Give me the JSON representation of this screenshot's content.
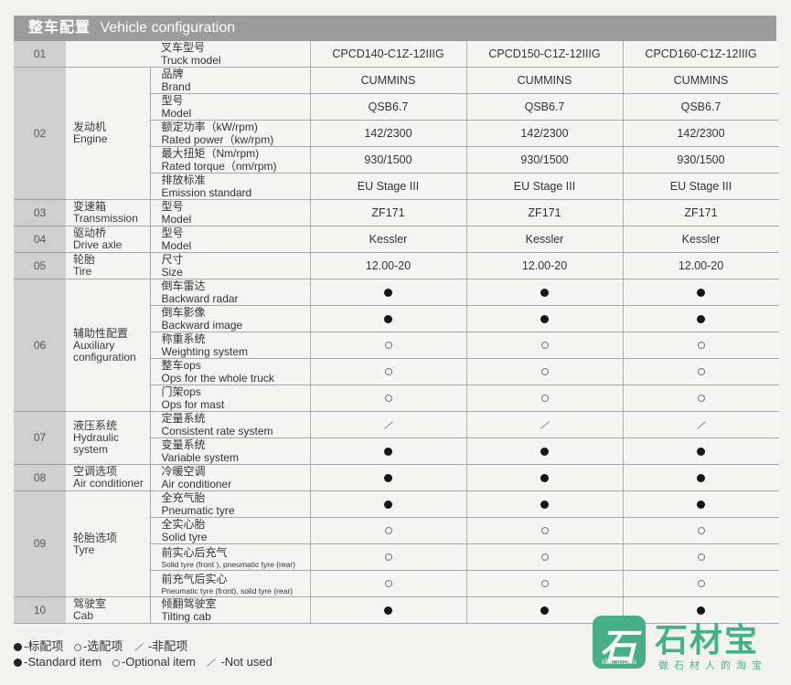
{
  "title": {
    "cn": "整车配置",
    "en": "Vehicle configuration"
  },
  "models": [
    "CPCD140-C1Z-12IIIG",
    "CPCD150-C1Z-12IIIG",
    "CPCD160-C1Z-12IIIG"
  ],
  "truck_model_label": {
    "cn": "叉车型号",
    "en": "Truck model"
  },
  "sections": [
    {
      "num": "01"
    },
    {
      "num": "02",
      "cat_cn": "发动机",
      "cat_en": "Engine",
      "items": [
        {
          "cn": "品牌",
          "en": "Brand",
          "values": [
            "CUMMINS",
            "CUMMINS",
            "CUMMINS"
          ]
        },
        {
          "cn": "型号",
          "en": "Model",
          "values": [
            "QSB6.7",
            "QSB6.7",
            "QSB6.7"
          ]
        },
        {
          "cn": "额定功率（kW/rpm)",
          "en": "Rated power（kw/rpm)",
          "values": [
            "142/2300",
            "142/2300",
            "142/2300"
          ]
        },
        {
          "cn": "最大扭矩（Nm/rpm)",
          "en": "Rated torque（nm/rpm)",
          "values": [
            "930/1500",
            "930/1500",
            "930/1500"
          ]
        },
        {
          "cn": "排放标准",
          "en": "Emission standard",
          "values": [
            "EU Stage III",
            "EU Stage III",
            "EU Stage III"
          ]
        }
      ]
    },
    {
      "num": "03",
      "cat_cn": "变速箱",
      "cat_en": "Transmission",
      "items": [
        {
          "cn": "型号",
          "en": "Model",
          "values": [
            "ZF171",
            "ZF171",
            "ZF171"
          ]
        }
      ]
    },
    {
      "num": "04",
      "cat_cn": "驱动桥",
      "cat_en": "Drive axle",
      "items": [
        {
          "cn": "型号",
          "en": "Model",
          "values": [
            "Kessler",
            "Kessler",
            "Kessler"
          ]
        }
      ]
    },
    {
      "num": "05",
      "cat_cn": "轮胎",
      "cat_en": "Tire",
      "items": [
        {
          "cn": "尺寸",
          "en": "Size",
          "values": [
            "12.00-20",
            "12.00-20",
            "12.00-20"
          ]
        }
      ]
    },
    {
      "num": "06",
      "cat_cn": "辅助性配置",
      "cat_en": "Auxiliary configuration",
      "items": [
        {
          "cn": "倒车雷达",
          "en": "Backward radar",
          "values": [
            "standard",
            "standard",
            "standard"
          ]
        },
        {
          "cn": "倒车影像",
          "en": "Backward image",
          "values": [
            "standard",
            "standard",
            "standard"
          ]
        },
        {
          "cn": "称重系统",
          "en": "Weighting system",
          "values": [
            "optional",
            "optional",
            "optional"
          ]
        },
        {
          "cn": "整车ops",
          "en": "Ops for the whole truck",
          "values": [
            "optional",
            "optional",
            "optional"
          ]
        },
        {
          "cn": "门架ops",
          "en": "Ops for mast",
          "values": [
            "optional",
            "optional",
            "optional"
          ]
        }
      ]
    },
    {
      "num": "07",
      "cat_cn": "液压系统",
      "cat_en": "Hydraulic system",
      "items": [
        {
          "cn": "定量系统",
          "en": "Consistent rate system",
          "values": [
            "not_used",
            "not_used",
            "not_used"
          ]
        },
        {
          "cn": "变量系统",
          "en": "Variable system",
          "values": [
            "standard",
            "standard",
            "standard"
          ]
        }
      ]
    },
    {
      "num": "08",
      "cat_cn": "空调选项",
      "cat_en": "Air conditioner",
      "items": [
        {
          "cn": "冷暖空调",
          "en": "Air conditioner",
          "values": [
            "standard",
            "standard",
            "standard"
          ]
        }
      ]
    },
    {
      "num": "09",
      "cat_cn": "轮胎选项",
      "cat_en": "Tyre",
      "items": [
        {
          "cn": "全充气胎",
          "en": "Pneumatic tyre",
          "values": [
            "standard",
            "standard",
            "standard"
          ]
        },
        {
          "cn": "全实心胎",
          "en": "Solid tyre",
          "values": [
            "optional",
            "optional",
            "optional"
          ]
        },
        {
          "cn": "前实心后充气",
          "en": "Solid tyre (front ), pneumatic tyre (rear)",
          "small": true,
          "values": [
            "optional",
            "optional",
            "optional"
          ]
        },
        {
          "cn": "前充气后实心",
          "en": "Pneumatic tyre (front), solid tyre (rear)",
          "small": true,
          "values": [
            "optional",
            "optional",
            "optional"
          ]
        }
      ]
    },
    {
      "num": "10",
      "cat_cn": "驾驶室",
      "cat_en": "Cab",
      "items": [
        {
          "cn": "倾翻驾驶室",
          "en": "Tilting cab",
          "values": [
            "standard",
            "standard",
            "standard"
          ]
        }
      ]
    }
  ],
  "legend": {
    "cn": {
      "standard": "-标配项",
      "optional": "-选配项",
      "not_used": "-非配项"
    },
    "en": {
      "standard": "-Standard item",
      "optional": "-Optional item",
      "not_used": "-Not used"
    }
  },
  "watermark": {
    "title": "石材宝",
    "slogan": "做石材人的淘宝",
    "logo_sub": "shicaibao",
    "color": "#47b089"
  }
}
